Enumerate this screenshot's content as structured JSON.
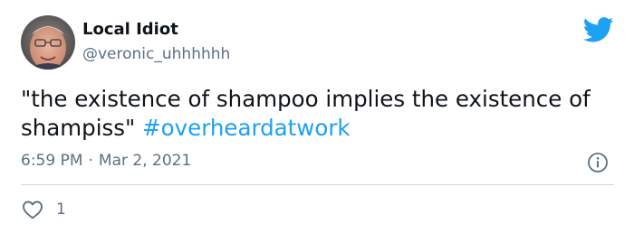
{
  "tweet": {
    "author": {
      "display_name": "Local Idiot",
      "handle": "@veronic_uhhhhhh",
      "avatar_icon": "person-face-avatar"
    },
    "text_line1": "\"the existence of shampoo implies the existence of",
    "text_line2": "shampiss\" ",
    "hashtag": "#overheardatwork",
    "time": "6:59 PM",
    "separator": "·",
    "date": "Mar 2, 2021",
    "like_count": "1"
  },
  "icons": {
    "brand": "twitter-bird-icon",
    "info": "info-circle-icon",
    "like": "heart-outline-icon"
  },
  "colors": {
    "accent": "#1da1f2",
    "text_primary": "#0f1419",
    "text_secondary": "#5b7083",
    "divider": "#cfd9de"
  }
}
